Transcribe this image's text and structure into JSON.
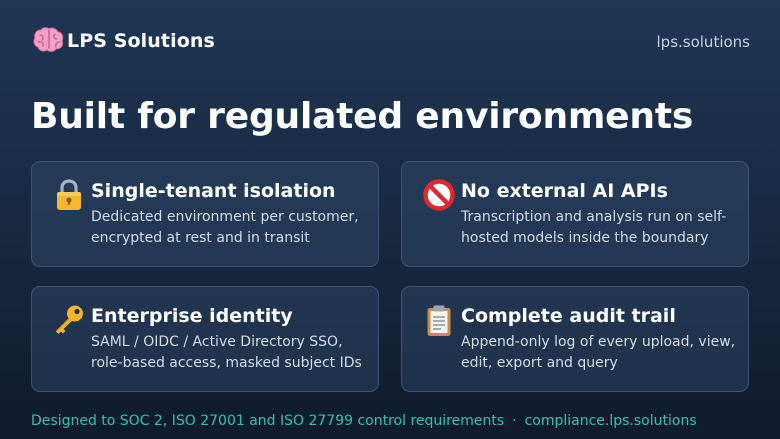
{
  "brand": {
    "name": "LPS Solutions",
    "icon": "brain-icon"
  },
  "site_link": "lps.solutions",
  "headline": "Built for regulated environments",
  "features": [
    {
      "icon": "lock-icon",
      "title": "Single-tenant isolation",
      "description": "Dedicated environment per customer, encrypted at rest and in transit"
    },
    {
      "icon": "prohibited-icon",
      "title": "No external AI APIs",
      "description": "Transcription and analysis run on self-hosted models inside the boundary"
    },
    {
      "icon": "key-icon",
      "title": "Enterprise identity",
      "description": "SAML / OIDC / Active Directory SSO, role-based access, masked subject IDs"
    },
    {
      "icon": "clipboard-icon",
      "title": "Complete audit trail",
      "description": "Append-only log of every upload, view, edit, export and query"
    }
  ],
  "footer": {
    "compliance_text": "Designed to SOC 2, ISO 27001 and ISO 27799 control requirements",
    "separator": "·",
    "compliance_link": "compliance.lps.solutions"
  },
  "colors": {
    "background_top": "#1f3655",
    "background_bottom": "#0f1b2c",
    "card_border": "#3d5474",
    "footer_accent": "#35c2b3"
  }
}
